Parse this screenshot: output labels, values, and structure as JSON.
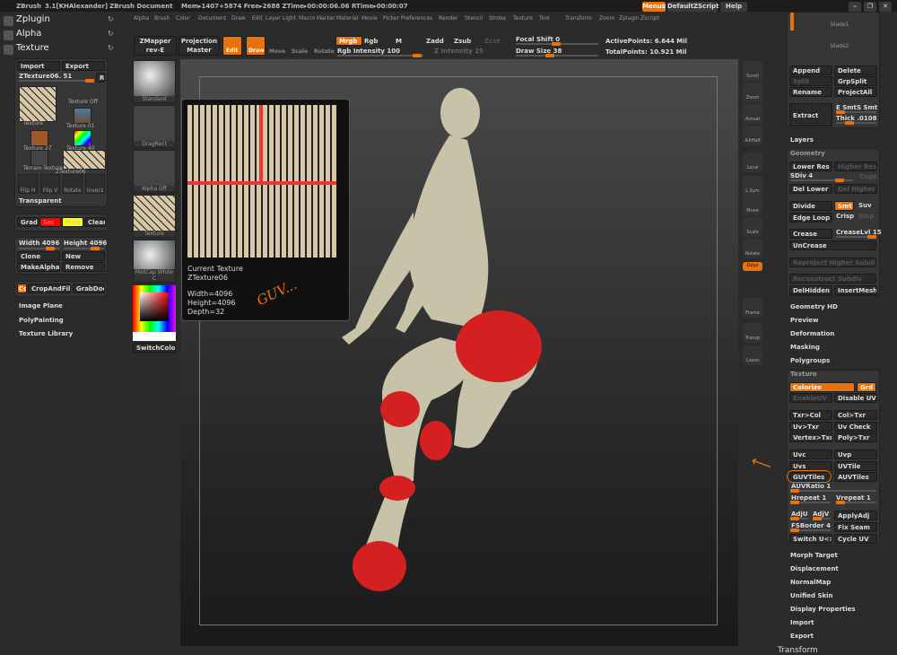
{
  "titlebar": {
    "app": "ZBrush",
    "version": "3.1[KHAlexander]",
    "document": "ZBrush Document",
    "stats": "Mem▸1407+5874 Free▸2688 ZTime▸00:00:06.06 RTime▸00:00:07",
    "menus": "Menus",
    "script": "DefaultZScript",
    "help": "Help"
  },
  "menubar": [
    "Alpha",
    "Brush",
    "Color",
    "Document",
    "Draw",
    "Edit",
    "Layer",
    "Light",
    "Macro",
    "Marker",
    "Material",
    "Movie",
    "Picker",
    "Preferences",
    "Render",
    "Stencil",
    "Stroke",
    "Texture",
    "Tool",
    "Transform",
    "Zoom",
    "Zplugin",
    "Zscript"
  ],
  "leftnav": [
    "Zplugin",
    "Alpha",
    "Texture"
  ],
  "texture_panel": {
    "import": "Import",
    "export": "Export",
    "current": "ZTexture06. 51",
    "r": "R",
    "thumbs": [
      "Texture",
      "Texture Off",
      "Texture 01",
      "Texture 27",
      "Texture 40",
      "Terrain Texture",
      "ZTexture06"
    ],
    "tools": [
      "Flip H",
      "Flip V",
      "Rotate",
      "Inverz"
    ],
    "transparent": "Transparent",
    "grad": "Grad",
    "sec": "Sec",
    "main": "Main",
    "clear": "Clear",
    "width": "Width 4096",
    "height": "Height 4096",
    "clone": "Clone",
    "new": "New",
    "makealpha": "MakeAlpha",
    "remove": "Remove",
    "cd": "Cd",
    "cropandfill": "CropAndFill",
    "grabdoc": "GrabDoc",
    "subs": [
      "Image Plane",
      "PolyPainting",
      "Texture Library"
    ]
  },
  "shelf": {
    "thumbs": [
      "Standard",
      "DragRect",
      "Alpha Off",
      "Texture",
      "MatCap White C"
    ],
    "switchcolor": "SwitchColor",
    "colors": {
      "sec": "#ff0000",
      "main": "#ffff00",
      "accent": "#e8720c"
    }
  },
  "toolbar": {
    "zmapper": "ZMapper",
    "zmapper2": "rev-E",
    "projection": "Projection",
    "projection2": "Master",
    "edit": "Edit",
    "draw": "Draw",
    "move": "Move",
    "scale": "Scale",
    "rotate": "Rotate",
    "mrgb": "Mrgb",
    "rgb": "Rgb",
    "m": "M",
    "rgb_intensity": "Rgb Intensity 100",
    "zadd": "Zadd",
    "zsub": "Zsub",
    "zcut": "Zcut",
    "z_intensity": "Z Intensity 25",
    "focal": "Focal Shift 0",
    "drawsize": "Draw Size 38",
    "active": "ActivePoints: 6.644 Mil",
    "total": "TotalPoints: 10.921 Mil"
  },
  "popup": {
    "title": "Current Texture",
    "name": "ZTexture06",
    "width": "Width=4096",
    "height": "Height=4096",
    "depth": "Depth=32",
    "annotation": "GUV..."
  },
  "right_icons": [
    "Scroll",
    "Zoom",
    "Actual",
    "AAHalf",
    "Local",
    "L.Sym",
    "Move",
    "Scale",
    "Rotate",
    "Gxyz",
    "Frame",
    "Transp",
    "Lasso"
  ],
  "subtool": {
    "items": [
      "blade1",
      "blade2"
    ],
    "append": "Append",
    "delete": "Delete",
    "split": "Split",
    "grpsplit": "GrpSplit",
    "rename": "Rename",
    "projectall": "ProjectAll",
    "extract": "Extract",
    "esmt": "E Smt",
    "ssmt": "S Smt",
    "thick": "Thick .0108"
  },
  "layers": "Layers",
  "geometry": {
    "title": "Geometry",
    "lower": "Lower Res",
    "higher": "Higher Res",
    "sdiv": "SDiv 4",
    "cage": "Cage",
    "dellower": "Del Lower",
    "delhigher": "Del Higher",
    "divide": "Divide",
    "smt": "Smt",
    "suv": "Suv",
    "edgeloop": "Edge Loop",
    "crisp": "Crisp",
    "disp": "Disp",
    "crease": "Crease",
    "creaselvl": "CreaseLvl 15",
    "uncrease": "UnCrease",
    "reproject": "Reproject Higher Subdiv",
    "reconstruct": "Reconstruct Subdiv",
    "delhidden": "DelHidden",
    "insertmesh": "InsertMesh"
  },
  "sections1": [
    "Geometry HD",
    "Preview",
    "Deformation",
    "Masking",
    "Polygroups"
  ],
  "texture": {
    "title": "Texture",
    "colorize": "Colorize",
    "grd": "Grd",
    "enableuv": "EnableUV",
    "disableuv": "Disable UV",
    "txrcol": "Txr>Col",
    "coltxr": "Col>Txr",
    "uvtxr": "Uv>Txr",
    "uvcheck": "Uv Check",
    "vertextxr": "Vertex>Txr",
    "polytxr": "Poly>Txr",
    "uvc": "Uvc",
    "uvp": "Uvp",
    "uvs": "Uvs",
    "uvtile": "UVTile",
    "guvtiles": "GUVTiles",
    "auvtiles": "AUVTiles",
    "auvratio": "AUVRatio 1",
    "hrepeat": "Hrepeat 1",
    "vrepeat": "Vrepeat 1",
    "adju": "AdjU",
    "adjv": "AdjV",
    "applyadj": "ApplyAdj",
    "fsborder": "FSBorder 4",
    "fixseam": "Fix Seam",
    "switchuv": "Switch U<>V",
    "cycleuv": "Cycle UV"
  },
  "sections2": [
    "Morph Target",
    "Displacement",
    "NormalMap",
    "Unified Skin",
    "Display Properties",
    "Import",
    "Export"
  ],
  "transform": "Transform"
}
